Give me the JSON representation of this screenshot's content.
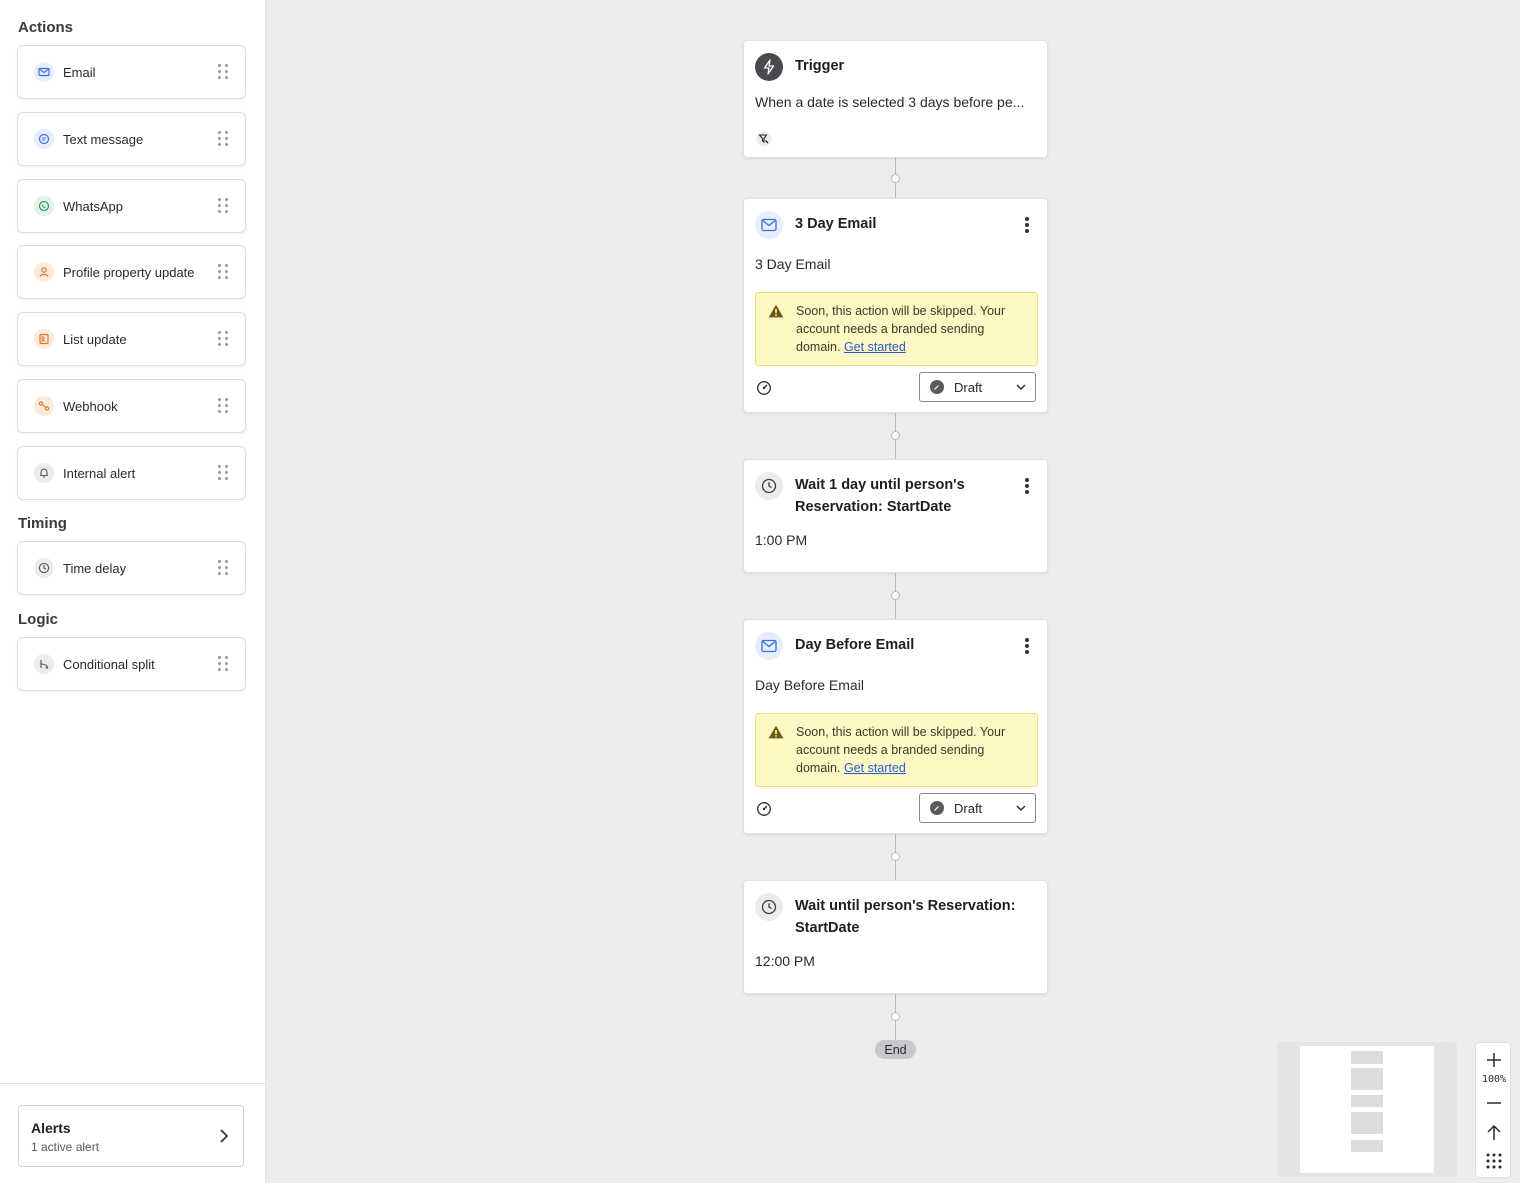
{
  "sidebar": {
    "sections": {
      "actions": "Actions",
      "timing": "Timing",
      "logic": "Logic"
    },
    "actions": [
      {
        "label": "Email",
        "icon": "mail-icon",
        "color": "#3b6fd6",
        "bg": "#e6eefb"
      },
      {
        "label": "Text message",
        "icon": "chat-icon",
        "color": "#3b6fd6",
        "bg": "#e6eefb"
      },
      {
        "label": "WhatsApp",
        "icon": "whatsapp-icon",
        "color": "#2f9e5a",
        "bg": "#e3f4ea"
      },
      {
        "label": "Profile property update",
        "icon": "profile-icon",
        "color": "#d9772b",
        "bg": "#fbeadb"
      },
      {
        "label": "List update",
        "icon": "list-icon",
        "color": "#d9772b",
        "bg": "#fbeadb"
      },
      {
        "label": "Webhook",
        "icon": "webhook-icon",
        "color": "#d9772b",
        "bg": "#fbeadb"
      },
      {
        "label": "Internal alert",
        "icon": "bell-icon",
        "color": "#555",
        "bg": "#ececee"
      }
    ],
    "timing": [
      {
        "label": "Time delay",
        "icon": "clock-icon",
        "color": "#555",
        "bg": "#ececee"
      }
    ],
    "logic": [
      {
        "label": "Conditional split",
        "icon": "split-icon",
        "color": "#555",
        "bg": "#ececee"
      }
    ],
    "alerts": {
      "title": "Alerts",
      "subtitle": "1 active alert"
    }
  },
  "flow": {
    "trigger": {
      "title": "Trigger",
      "body": "When a date is selected 3 days before pe..."
    },
    "email1": {
      "title": "3 Day Email",
      "body": "3 Day Email",
      "warning": "Soon, this action will be skipped. Your account needs a branded sending domain.",
      "link": "Get started",
      "status": "Draft"
    },
    "wait1": {
      "title": "Wait 1 day until person's Reservation: StartDate",
      "body": "1:00 PM"
    },
    "email2": {
      "title": "Day Before Email",
      "body": "Day Before Email",
      "warning": "Soon, this action will be skipped. Your account needs a branded sending domain.",
      "link": "Get started",
      "status": "Draft"
    },
    "wait2": {
      "title": "Wait until person's Reservation: StartDate",
      "body": "12:00 PM"
    },
    "end": "End"
  },
  "zoom": {
    "level": "100%"
  },
  "colors": {
    "warning_bg": "#fdf8c4",
    "link": "#2a5bd7",
    "canvas": "#ececee"
  }
}
